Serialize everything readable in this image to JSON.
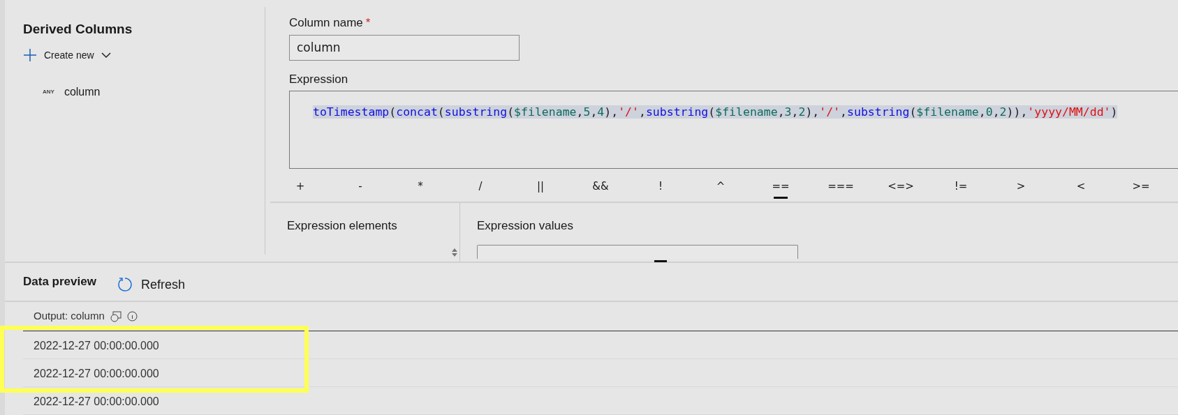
{
  "sidebar": {
    "title": "Derived Columns",
    "create_button": "Create new",
    "items": [
      {
        "type_badge": "ANY",
        "name": "column"
      }
    ]
  },
  "column_name": {
    "label": "Column name",
    "required_mark": "*",
    "value": "column"
  },
  "expression": {
    "label": "Expression",
    "tokens": [
      {
        "kind": "function",
        "text": "toTimestamp"
      },
      {
        "kind": "punct",
        "text": "("
      },
      {
        "kind": "function",
        "text": "concat"
      },
      {
        "kind": "punct",
        "text": "("
      },
      {
        "kind": "function",
        "text": "substring"
      },
      {
        "kind": "punct",
        "text": "("
      },
      {
        "kind": "variable",
        "text": "$filename"
      },
      {
        "kind": "punct",
        "text": ","
      },
      {
        "kind": "number",
        "text": "5"
      },
      {
        "kind": "punct",
        "text": ","
      },
      {
        "kind": "number",
        "text": "4"
      },
      {
        "kind": "punct",
        "text": "),"
      },
      {
        "kind": "string",
        "text": "'/'"
      },
      {
        "kind": "punct",
        "text": ","
      },
      {
        "kind": "function",
        "text": "substring"
      },
      {
        "kind": "punct",
        "text": "("
      },
      {
        "kind": "variable",
        "text": "$filename"
      },
      {
        "kind": "punct",
        "text": ","
      },
      {
        "kind": "number",
        "text": "3"
      },
      {
        "kind": "punct",
        "text": ","
      },
      {
        "kind": "number",
        "text": "2"
      },
      {
        "kind": "punct",
        "text": "),"
      },
      {
        "kind": "string",
        "text": "'/'"
      },
      {
        "kind": "punct",
        "text": ","
      },
      {
        "kind": "function",
        "text": "substring"
      },
      {
        "kind": "punct",
        "text": "("
      },
      {
        "kind": "variable",
        "text": "$filename"
      },
      {
        "kind": "punct",
        "text": ","
      },
      {
        "kind": "number",
        "text": "0"
      },
      {
        "kind": "punct",
        "text": ","
      },
      {
        "kind": "number",
        "text": "2"
      },
      {
        "kind": "punct",
        "text": ")),"
      },
      {
        "kind": "string",
        "text": "'yyyy/MM/dd'"
      },
      {
        "kind": "punct",
        "text": ")"
      }
    ]
  },
  "operators": [
    {
      "label": "+",
      "selected": false
    },
    {
      "label": "-",
      "selected": false
    },
    {
      "label": "*",
      "selected": false
    },
    {
      "label": "/",
      "selected": false
    },
    {
      "label": "||",
      "selected": false
    },
    {
      "label": "&&",
      "selected": false
    },
    {
      "label": "!",
      "selected": false
    },
    {
      "label": "^",
      "selected": false
    },
    {
      "label": "==",
      "selected": true
    },
    {
      "label": "===",
      "selected": false
    },
    {
      "label": "<=>",
      "selected": false
    },
    {
      "label": "!=",
      "selected": false
    },
    {
      "label": ">",
      "selected": false
    },
    {
      "label": "<",
      "selected": false
    },
    {
      "label": ">=",
      "selected": false
    }
  ],
  "expression_elements": {
    "title": "Expression elements"
  },
  "expression_values": {
    "title": "Expression values"
  },
  "data_preview": {
    "title": "Data preview",
    "refresh_button": "Refresh",
    "column_header": "Output: column",
    "rows": [
      "2022-12-27 00:00:00.000",
      "2022-12-27 00:00:00.000",
      "2022-12-27 00:00:00.000"
    ]
  }
}
